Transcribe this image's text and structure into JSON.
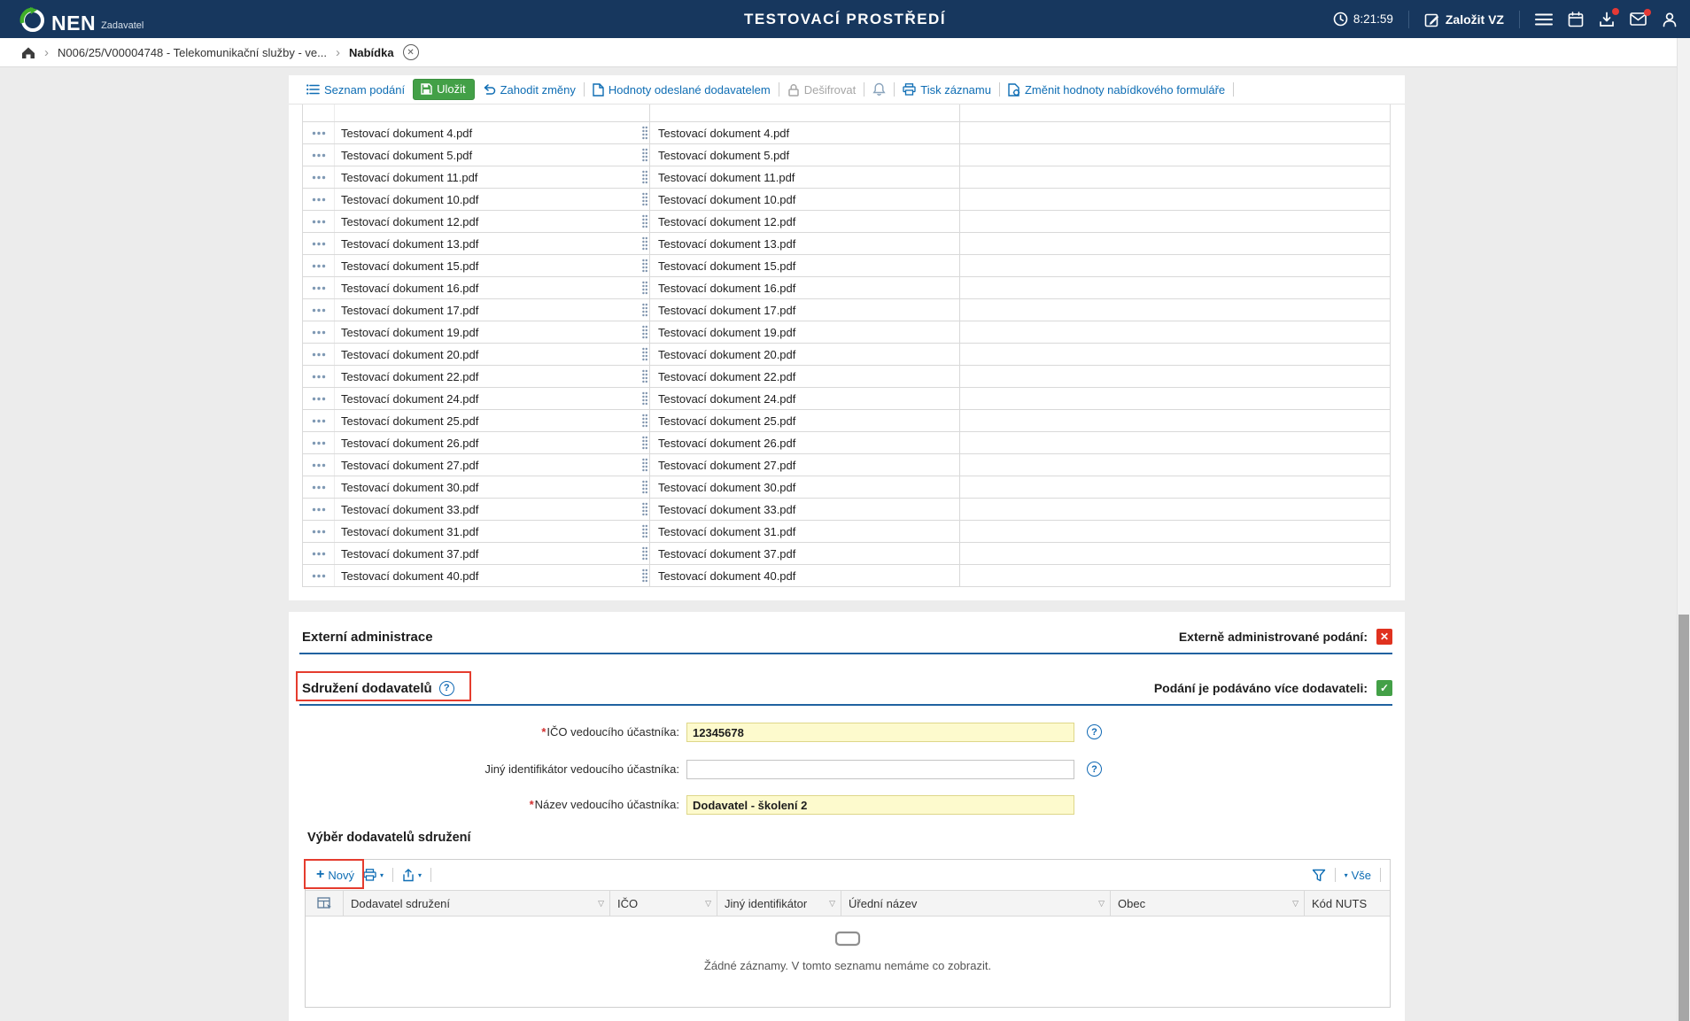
{
  "colors": {
    "header_navy": "#17375e",
    "accent_blue": "#0e6db4",
    "save_green": "#43a047",
    "check_green": "#43a047",
    "cross_red": "#e0321f",
    "annotation_red": "#e53c2e",
    "required_red": "#d32f2f",
    "input_yellow": "#fdfacd",
    "section_line": "#2062a0"
  },
  "icons": {
    "chevron": "›",
    "caret_down": "▾",
    "filter_caret": "▽",
    "close": "✕",
    "check": "✓",
    "cross": "✕",
    "help": "?",
    "plus": "+"
  },
  "header": {
    "logo_text": "NEN",
    "logo_subtitle": "Zadavatel",
    "title": "TESTOVACÍ PROSTŘEDÍ",
    "time": "8:21:59",
    "create_button": "Založit VZ"
  },
  "breadcrumb": {
    "procurement": "N006/25/V00004748 - Telekomunikační služby - ve...",
    "current": "Nabídka"
  },
  "toolbar": {
    "seznam_podani": "Seznam podání",
    "ulozit": "Uložit",
    "zahodit_zmeny": "Zahodit změny",
    "hodnoty_odeslane": "Hodnoty odeslané dodavatelem",
    "desifrovat": "Dešifrovat",
    "tisk_zaznamu": "Tisk záznamu",
    "zmenit_hodnoty": "Změnit hodnoty nabídkového formuláře"
  },
  "documents": {
    "rows": [
      "Testovací dokument 4.pdf",
      "Testovací dokument 5.pdf",
      "Testovací dokument 11.pdf",
      "Testovací dokument 10.pdf",
      "Testovací dokument 12.pdf",
      "Testovací dokument 13.pdf",
      "Testovací dokument 15.pdf",
      "Testovací dokument 16.pdf",
      "Testovací dokument 17.pdf",
      "Testovací dokument 19.pdf",
      "Testovací dokument 20.pdf",
      "Testovací dokument 22.pdf",
      "Testovací dokument 24.pdf",
      "Testovací dokument 25.pdf",
      "Testovací dokument 26.pdf",
      "Testovací dokument 27.pdf",
      "Testovací dokument 30.pdf",
      "Testovací dokument 33.pdf",
      "Testovací dokument 31.pdf",
      "Testovací dokument 37.pdf",
      "Testovací dokument 40.pdf"
    ]
  },
  "external_section": {
    "title": "Externí administrace",
    "checkbox_label": "Externě administrované podání:"
  },
  "association_section": {
    "title": "Sdružení dodavatelů",
    "checkbox_label": "Podání je podáváno více dodavateli:"
  },
  "form": {
    "fields": [
      {
        "required": "*",
        "label": "IČO vedoucího účastníka:",
        "value": "12345678"
      },
      {
        "required": "",
        "label": "Jiný identifikátor vedoucího účastníka:",
        "value": ""
      },
      {
        "required": "*",
        "label": "Název vedoucího účastníka:",
        "value": "Dodavatel - školení 2"
      }
    ]
  },
  "suppliers": {
    "title": "Výběr dodavatelů sdružení",
    "new_button": "Nový",
    "all_label": "Vše",
    "columns": [
      "Dodavatel sdružení",
      "IČO",
      "Jiný identifikátor",
      "Úřední název",
      "Obec",
      "Kód NUTS"
    ],
    "empty_text": "Žádné záznamy. V tomto seznamu nemáme co zobrazit."
  }
}
